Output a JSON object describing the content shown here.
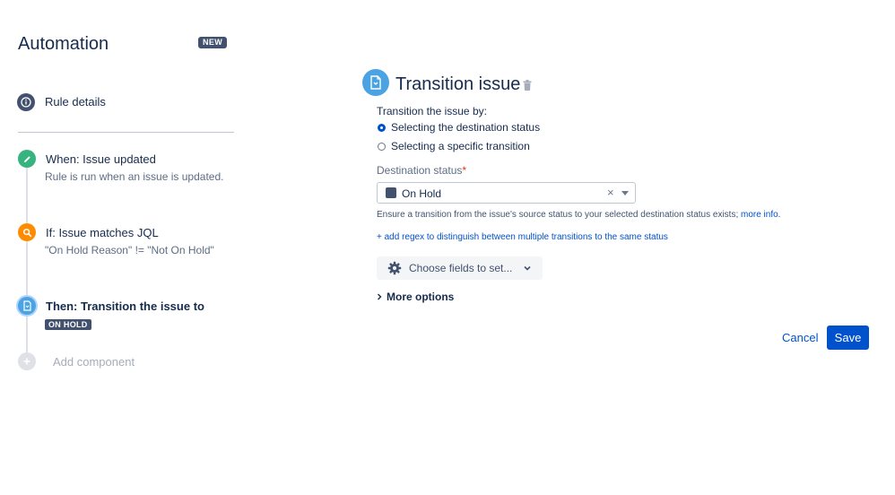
{
  "sidebar": {
    "app_title": "Automation",
    "badge": "NEW",
    "rule_details": "Rule details",
    "steps": [
      {
        "title": "When: Issue updated",
        "desc": "Rule is run when an issue is updated.",
        "color": "#36b37e",
        "icon": "pencil-icon"
      },
      {
        "title": "If: Issue matches JQL",
        "desc": "\"On Hold Reason\" != \"Not On Hold\"",
        "color": "#ff8b00",
        "icon": "search-icon"
      },
      {
        "title": "Then: Transition the issue to",
        "lozenge": "ON HOLD",
        "color": "#4ba3e3",
        "icon": "transition-icon"
      }
    ],
    "add_component": "Add component"
  },
  "main": {
    "title": "Transition issue",
    "transition_by_label": "Transition the issue by:",
    "options": [
      {
        "label": "Selecting the destination status",
        "checked": true
      },
      {
        "label": "Selecting a specific transition",
        "checked": false
      }
    ],
    "destination_label": "Destination status",
    "required_mark": "*",
    "destination_value": "On Hold",
    "hint_text": "Ensure a transition from the issue's source status to your selected destination status exists;",
    "hint_link": "more info.",
    "regex_link": "+ add regex to distinguish between multiple transitions to the same status",
    "choose_fields": "Choose fields to set...",
    "more_options": "More options",
    "cancel": "Cancel",
    "save": "Save"
  },
  "colors": {
    "primary": "#0052cc",
    "neutral": "#42526e",
    "icon_blue": "#4ba3e3"
  }
}
